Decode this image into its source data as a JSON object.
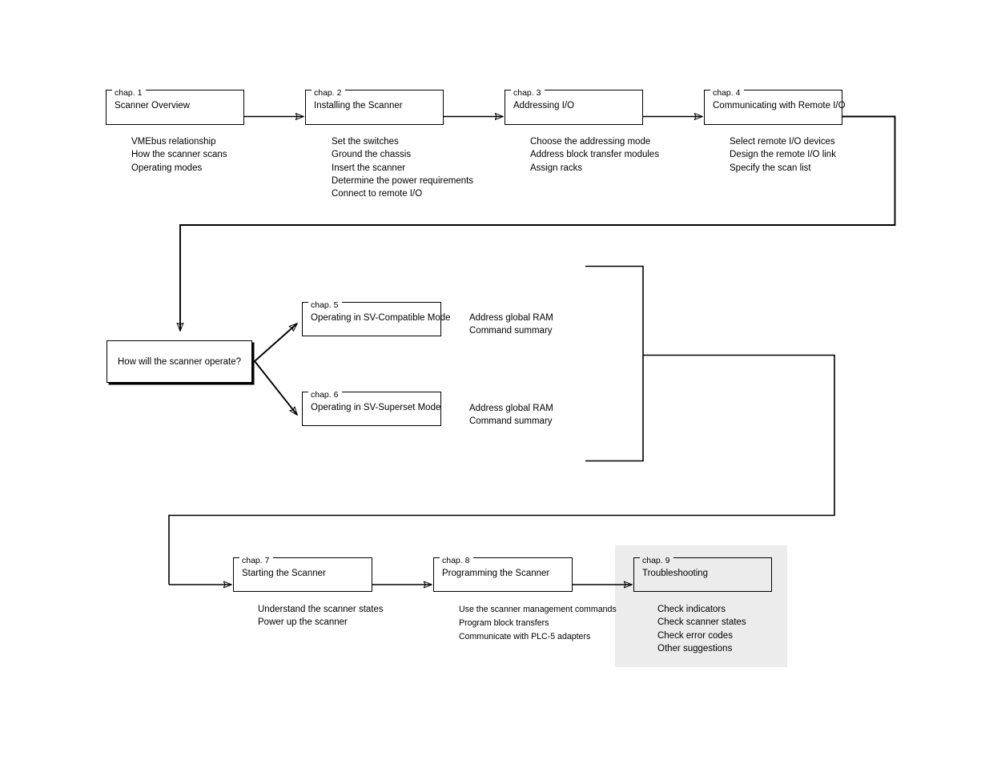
{
  "diagram": {
    "title": "Manual roadmap — scanner documentation flowchart",
    "background_color": "#ffffff",
    "line_color": "#000000",
    "shade_color": "#ececec"
  },
  "chapters": [
    {
      "legend": "chap. 1",
      "title": "Scanner Overview",
      "bullets": [
        "VMEbus relationship",
        "How the scanner scans",
        "Operating modes"
      ]
    },
    {
      "legend": "chap. 2",
      "title": "Installing the Scanner",
      "bullets": [
        "Set the switches",
        "Ground the chassis",
        "Insert the scanner",
        "Determine the power requirements",
        "Connect to remote I/O"
      ]
    },
    {
      "legend": "chap. 3",
      "title": "Addressing I/O",
      "bullets": [
        "Choose the addressing mode",
        "Address block transfer modules",
        "Assign racks"
      ]
    },
    {
      "legend": "chap. 4",
      "title": "Communicating with Remote I/O",
      "bullets": [
        "Select remote I/O devices",
        "Design the remote I/O link",
        "Specify the scan list"
      ]
    },
    {
      "legend": "chap. 5",
      "title": "Operating in SV-Compatible Mode",
      "bullets": [
        "Address global RAM",
        "Command summary"
      ]
    },
    {
      "legend": "chap. 6",
      "title": "Operating in SV-Superset Mode",
      "bullets": [
        "Address global RAM",
        "Command summary"
      ]
    },
    {
      "legend": "chap. 7",
      "title": "Starting the Scanner",
      "bullets": [
        "Understand the scanner states",
        "Power up the scanner"
      ]
    },
    {
      "legend": "chap. 8",
      "title": "Programming the Scanner",
      "bullets": [
        "Use the scanner management commands",
        "Program block transfers",
        "Communicate with PLC-5 adapters"
      ]
    },
    {
      "legend": "chap. 9",
      "title": "Troubleshooting",
      "bullets": [
        "Check indicators",
        "Check scanner states",
        "Check error codes",
        "Other suggestions"
      ]
    }
  ],
  "decision": {
    "text": "How will the scanner operate?"
  }
}
